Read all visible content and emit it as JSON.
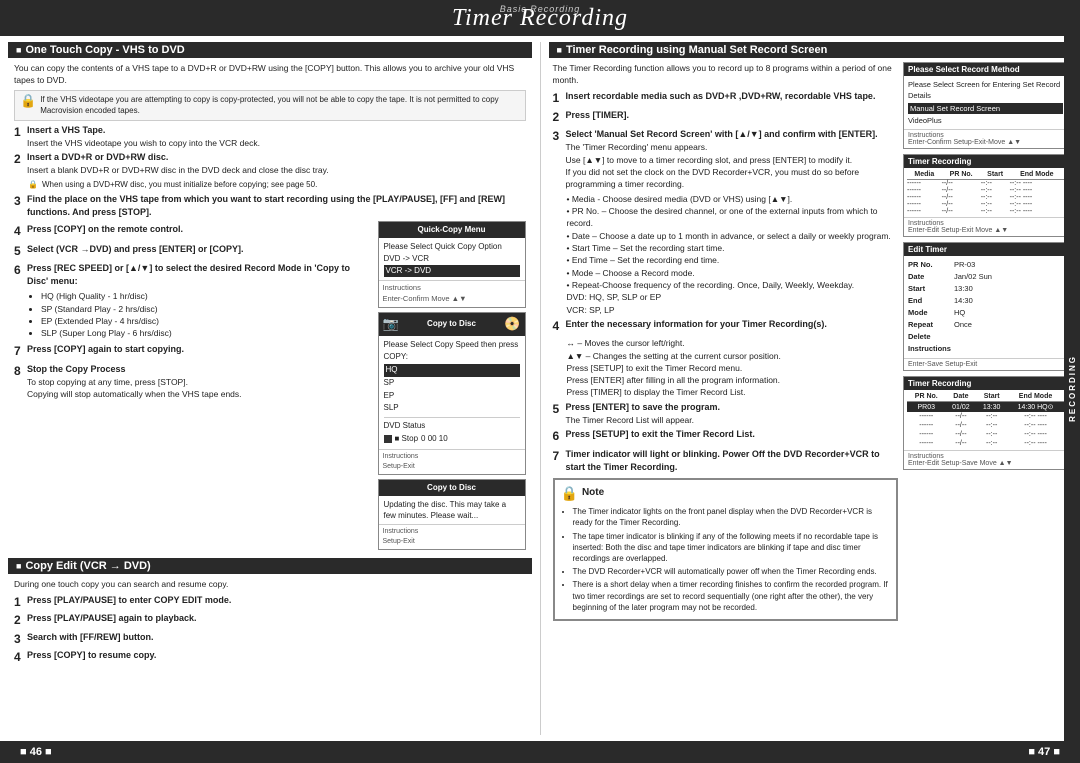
{
  "header": {
    "subtitle": "Basic Recording",
    "title": "Timer Recording"
  },
  "footer": {
    "left": "■ 46 ■",
    "right": "■ 47 ■"
  },
  "sidebar_right": "RECORDING",
  "left_section": {
    "title": "One Touch Copy - VHS to DVD",
    "intro": "You can copy the contents of a VHS tape to a DVD+R or DVD+RW using the [COPY] button. This allows you to archive your old VHS tapes to DVD.",
    "note": "If the VHS videotape you are attempting to copy is copy-protected, you will not be able to copy the tape. It is not permitted to copy Macrovision encoded tapes.",
    "steps": [
      {
        "num": "1",
        "label": "Insert a VHS Tape.",
        "detail": "Insert the VHS videotape you wish to copy into the VCR deck."
      },
      {
        "num": "2",
        "label": "Insert a DVD+R or DVD+RW disc.",
        "detail": "Insert a blank DVD+R or DVD+RW disc in the DVD deck and close the disc tray."
      },
      {
        "num": "",
        "label": "",
        "detail": "When using a DVD+RW disc, you must initialize before copying; see page 50.",
        "is_bullet": true
      },
      {
        "num": "3",
        "label": "Find the place on the VHS tape from which you want to start recording using the [PLAY/PAUSE], [FF] and [REW] functions. And press [STOP].",
        "detail": ""
      },
      {
        "num": "4",
        "label": "Press [COPY] on the remote control.",
        "detail": ""
      },
      {
        "num": "5",
        "label": "Select (VCR →DVD) and press [ENTER] or [COPY].",
        "detail": ""
      },
      {
        "num": "6",
        "label": "Press [REC SPEED] or [▲/▼] to select the desired Record Mode in 'Copy to Disc' menu:",
        "detail": ""
      }
    ],
    "bullet_modes": [
      "HQ (High Quality - 1 hr/disc)",
      "SP (Standard Play - 2 hrs/disc)",
      "EP (Extended Play - 4 hrs/disc)",
      "SLP (Super Long Play - 6 hrs/disc)"
    ],
    "steps2": [
      {
        "num": "7",
        "label": "Press [COPY] again to start copying.",
        "detail": ""
      },
      {
        "num": "8",
        "label": "Stop the Copy Process",
        "detail": "To stop copying at any time, press [STOP].\nCopying will stop automatically when the VHS tape ends."
      }
    ],
    "quick_copy_menu": {
      "title": "Quick-Copy Menu",
      "line1": "Please Select Quick Copy Option",
      "options": [
        "DVD -> VCR",
        "VCR -> DVD"
      ],
      "instructions": "Instructions",
      "nav": "Enter-Confirm  Move ▲▼"
    },
    "copy_to_disc1": {
      "title": "Copy to Disc",
      "line1": "Please Select Copy Speed then press COPY:",
      "options": [
        "HQ",
        "SP",
        "EP",
        "SLP"
      ],
      "dvd_status": "DVD Status",
      "stop_label": "■ Stop",
      "time": "0  00  10",
      "instructions": "Instructions",
      "nav": "Setup-Exit"
    },
    "copy_to_disc2": {
      "title": "Copy to Disc",
      "line1": "Updating the disc. This may take a few minutes. Please wait...",
      "instructions": "Instructions",
      "nav": "Setup-Exit"
    }
  },
  "copy_edit_section": {
    "title": "Copy Edit (VCR → DVD)",
    "intro": "During one touch copy you can search and resume copy.",
    "steps": [
      {
        "num": "1",
        "label": "Press [PLAY/PAUSE] to enter COPY EDIT mode."
      },
      {
        "num": "2",
        "label": "Press [PLAY/PAUSE] again to playback."
      },
      {
        "num": "3",
        "label": "Search with [FF/REW] button."
      },
      {
        "num": "4",
        "label": "Press [COPY] to resume copy."
      }
    ]
  },
  "right_section": {
    "title": "Timer Recording using Manual Set Record Screen",
    "intro": "The Timer Recording function allows you to record up to 8 programs within a period of one month.",
    "steps": [
      {
        "num": "1",
        "label": "Insert recordable media such as DVD+R ,DVD+RW, recordable VHS tape."
      },
      {
        "num": "2",
        "label": "Press [TIMER]."
      },
      {
        "num": "3",
        "label": "Select 'Manual Set Record Screen' with [▲/▼] and confirm with [ENTER].",
        "detail": "The 'Timer Recording' menu appears.\nUse [▲▼] to move to a timer recording slot, and press [ENTER] to modify it.\nIf you did not set the clock on the DVD Recorder+VCR, you must do so before programming a timer recording."
      },
      {
        "num": "",
        "label": "Media - Choose desired media (DVD or VHS) using [▲▼].",
        "is_bullet": true
      },
      {
        "num": "",
        "label": "PR No. – Choose the desired channel, or one of the external inputs from which to record.",
        "is_bullet": true
      },
      {
        "num": "",
        "label": "Date – Choose a date up to 1 month in advance, or select a daily or weekly program.",
        "is_bullet": true
      },
      {
        "num": "",
        "label": "Start Time – Set the recording start time.",
        "is_bullet": true
      },
      {
        "num": "",
        "label": "End Time – Set the recording end time.",
        "is_bullet": true
      },
      {
        "num": "",
        "label": "Mode – Choose a Record mode.",
        "is_bullet": true
      },
      {
        "num": "",
        "label": "Repeat-Choose frequency of the recording. Once, Daily, Weekly, Weekday.",
        "is_bullet": true
      },
      {
        "num": "",
        "label": "DVD: HQ, SP, SLP or EP",
        "is_bullet": true
      },
      {
        "num": "",
        "label": "VCR: SP, LP",
        "is_bullet": true
      }
    ],
    "steps2": [
      {
        "num": "4",
        "label": "Enter the necessary information for your Timer Recording(s).",
        "detail": ""
      },
      {
        "num": "",
        "label": "↔ – Moves the cursor left/right.",
        "is_bullet": true
      },
      {
        "num": "",
        "label": "▲▼ – Changes the setting at the current cursor position.",
        "is_bullet": true
      },
      {
        "num": "",
        "label": "Press [SETUP] to exit the Timer Record menu.",
        "is_bullet": true
      },
      {
        "num": "",
        "label": "Press [ENTER] after filling in all the program information.",
        "is_bullet": true
      },
      {
        "num": "",
        "label": "Press [TIMER] to display the Timer Record List.",
        "is_bullet": true
      }
    ],
    "steps3": [
      {
        "num": "5",
        "label": "Press [ENTER] to save the program.",
        "detail": "The Timer Record List will appear."
      },
      {
        "num": "6",
        "label": "Press [SETUP] to exit the Timer Record List."
      },
      {
        "num": "7",
        "label": "Timer indicator will light or blinking. Power Off the DVD Recorder+VCR to start the Timer Recording."
      }
    ],
    "note_items": [
      "The Timer indicator lights on the front panel display when the DVD Recorder+VCR is ready for the Timer Recording.",
      "The tape timer indicator is blinking if any of the following meets if no recordable tape is inserted: Both the disc and tape timer indicators are blinking if tape and disc timer recordings are overlapped.",
      "The DVD Recorder+VCR will automatically power off when the Timer Recording ends.",
      "There is a short delay when a timer recording finishes to confirm the recorded program. If two timer recordings are set to record sequentially (one right after the other), the very beginning of the later program may not be recorded."
    ],
    "please_select_panel": {
      "title": "Please Select Record Method",
      "line1": "Please Select Screen for Entering Set Record Details",
      "options": [
        "Manual Set Record Screen",
        "VideoPlus"
      ],
      "instructions": "Instructions",
      "nav": "Enter-Confirm  Setup-Exit-Move ▲▼"
    },
    "timer_recording_panel1": {
      "title": "Timer Recording",
      "headers": [
        "Media",
        "PR No.",
        "Start",
        "End Mode"
      ],
      "rows": [
        [
          "------",
          "--/--",
          "--:--",
          "--:-- ----"
        ],
        [
          "------",
          "--/--",
          "--:--",
          "--:-- ----"
        ],
        [
          "------",
          "--/--",
          "--:--",
          "--:-- ----"
        ],
        [
          "------",
          "--/--",
          "--:--",
          "--:-- ----"
        ],
        [
          "------",
          "--/--",
          "--:--",
          "--:-- ----"
        ]
      ],
      "instructions": "Instructions",
      "nav": "Enter-Edit  Setup-Exit  Move ▲▼"
    },
    "edit_timer_panel": {
      "title": "Edit Timer",
      "fields": [
        {
          "label": "PR No.",
          "value": "PR-03"
        },
        {
          "label": "Date",
          "value": "Jan/02 Sun"
        },
        {
          "label": "Start",
          "value": "13:30"
        },
        {
          "label": "End",
          "value": "14:30"
        },
        {
          "label": "Mode",
          "value": "HQ"
        },
        {
          "label": "Repeat",
          "value": "Once"
        },
        {
          "label": "Delete",
          "value": ""
        },
        {
          "label": "Instructions",
          "value": ""
        }
      ],
      "nav": "Enter-Save  Setup-Exit"
    },
    "timer_recording_panel2": {
      "title": "Timer Recording",
      "headers": [
        "PR No.",
        "Date",
        "Start",
        "End Mode"
      ],
      "highlight_row": [
        "PR03",
        "01/02/13:30",
        "14:30",
        "HQ ⊙"
      ],
      "rows": [
        [
          "------",
          "--/--",
          "--:--",
          "--:-- ----"
        ],
        [
          "------",
          "--/--",
          "--:--",
          "--:-- ----"
        ],
        [
          "------",
          "--/--",
          "--:--",
          "--:-- ----"
        ],
        [
          "------",
          "--/--",
          "--:--",
          "--:-- ----"
        ]
      ],
      "instructions": "Instructions",
      "nav": "Enter-Edit  Setup-Save  Move ▲▼"
    }
  }
}
